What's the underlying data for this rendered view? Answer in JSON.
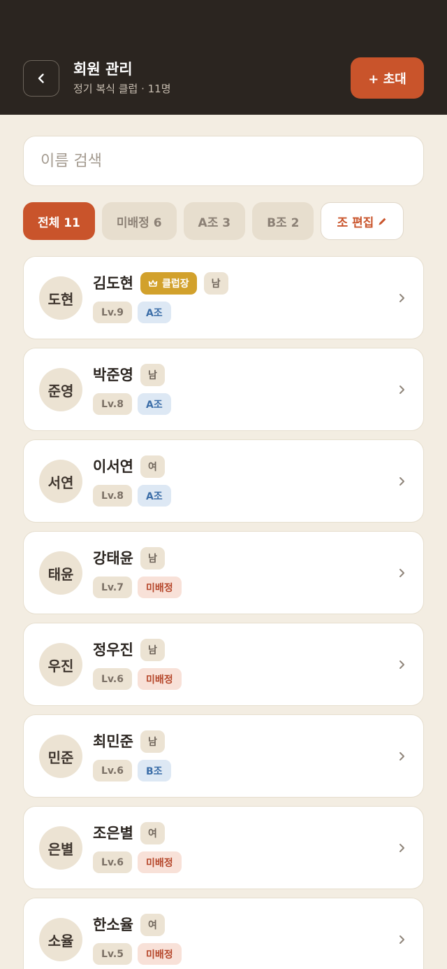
{
  "header": {
    "title": "회원 관리",
    "subtitle": "정기 복식 클럽 · 11명",
    "invite_label": "+ 초대"
  },
  "search": {
    "placeholder": "이름 검색",
    "value": ""
  },
  "filters": {
    "all": "전체 11",
    "unassigned": "미배정 6",
    "group_a": "A조 3",
    "group_b": "B조 2",
    "edit": "조 편집"
  },
  "members": [
    {
      "avatar": "도현",
      "name": "김도현",
      "role": "클럽장",
      "gender": "남",
      "level": "Lv.9",
      "group": "A조",
      "group_status": "assigned"
    },
    {
      "avatar": "준영",
      "name": "박준영",
      "role": "",
      "gender": "남",
      "level": "Lv.8",
      "group": "A조",
      "group_status": "assigned"
    },
    {
      "avatar": "서연",
      "name": "이서연",
      "role": "",
      "gender": "여",
      "level": "Lv.8",
      "group": "A조",
      "group_status": "assigned"
    },
    {
      "avatar": "태윤",
      "name": "강태윤",
      "role": "",
      "gender": "남",
      "level": "Lv.7",
      "group": "미배정",
      "group_status": "unassigned"
    },
    {
      "avatar": "우진",
      "name": "정우진",
      "role": "",
      "gender": "남",
      "level": "Lv.6",
      "group": "미배정",
      "group_status": "unassigned"
    },
    {
      "avatar": "민준",
      "name": "최민준",
      "role": "",
      "gender": "남",
      "level": "Lv.6",
      "group": "B조",
      "group_status": "assigned"
    },
    {
      "avatar": "은별",
      "name": "조은별",
      "role": "",
      "gender": "여",
      "level": "Lv.6",
      "group": "미배정",
      "group_status": "unassigned"
    },
    {
      "avatar": "소율",
      "name": "한소율",
      "role": "",
      "gender": "여",
      "level": "Lv.5",
      "group": "미배정",
      "group_status": "unassigned"
    }
  ],
  "colors": {
    "header_bg": "#2b2520",
    "accent": "#c9542b",
    "leader_gold": "#d2a12c",
    "page_bg": "#f3ede2"
  },
  "icons": {
    "back": "chevron-left-icon",
    "edit": "pencil-icon",
    "leader": "crown-icon",
    "row_action": "chevron-right-icon"
  }
}
